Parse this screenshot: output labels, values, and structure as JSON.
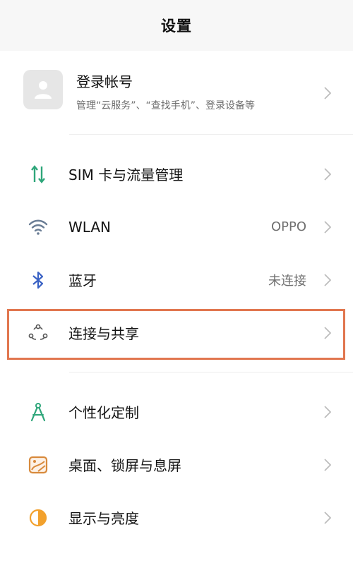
{
  "header": {
    "title": "设置"
  },
  "account": {
    "title": "登录帐号",
    "subtitle": "管理“云服务”、“查找手机”、登录设备等",
    "avatar_icon": "user-icon"
  },
  "groups": [
    {
      "items": [
        {
          "label": "SIM 卡与流量管理",
          "value": "",
          "icon": "sim-data-icon"
        },
        {
          "label": "WLAN",
          "value": "OPPO",
          "icon": "wifi-icon"
        },
        {
          "label": "蓝牙",
          "value": "未连接",
          "icon": "bluetooth-icon"
        },
        {
          "label": "连接与共享",
          "value": "",
          "icon": "connection-share-icon"
        }
      ]
    },
    {
      "items": [
        {
          "label": "个性化定制",
          "value": "",
          "icon": "compass-icon"
        },
        {
          "label": "桌面、锁屏与息屏",
          "value": "",
          "icon": "wallpaper-icon"
        },
        {
          "label": "显示与亮度",
          "value": "",
          "icon": "brightness-icon"
        }
      ]
    }
  ],
  "colors": {
    "accent_green": "#2ea67a",
    "highlight": "#e1764f",
    "sim_icon": "#2ea67a",
    "wifi_icon": "#6a7d95",
    "bluetooth_icon": "#3a62c4",
    "wallpaper_icon": "#d88a3c",
    "brightness_icon": "#f2a12d"
  }
}
